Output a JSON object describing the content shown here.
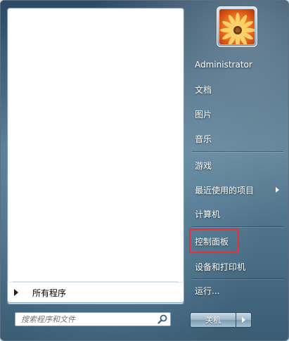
{
  "start_menu": {
    "user_name": "Administrator",
    "right_items": [
      {
        "label": "文档",
        "has_submenu": false
      },
      {
        "label": "图片",
        "has_submenu": false
      },
      {
        "label": "音乐",
        "has_submenu": false
      },
      {
        "label": "游戏",
        "has_submenu": false
      },
      {
        "label": "最近使用的项目",
        "has_submenu": true
      },
      {
        "label": "计算机",
        "has_submenu": false
      },
      {
        "label": "控制面板",
        "has_submenu": false,
        "highlighted": true
      },
      {
        "label": "设备和打印机",
        "has_submenu": false
      },
      {
        "label": "运行...",
        "has_submenu": false
      }
    ],
    "all_programs_label": "所有程序",
    "search": {
      "placeholder": "搜索程序和文件",
      "value": "",
      "icon": "search-icon"
    },
    "shutdown": {
      "label": "关机",
      "arrow_icon": "chevron-right-icon"
    },
    "avatar_icon": "flower-avatar-icon"
  },
  "colors": {
    "highlight_border": "#e8303a",
    "menu_text": "#ffffff",
    "pane_background": "#ffffff"
  }
}
